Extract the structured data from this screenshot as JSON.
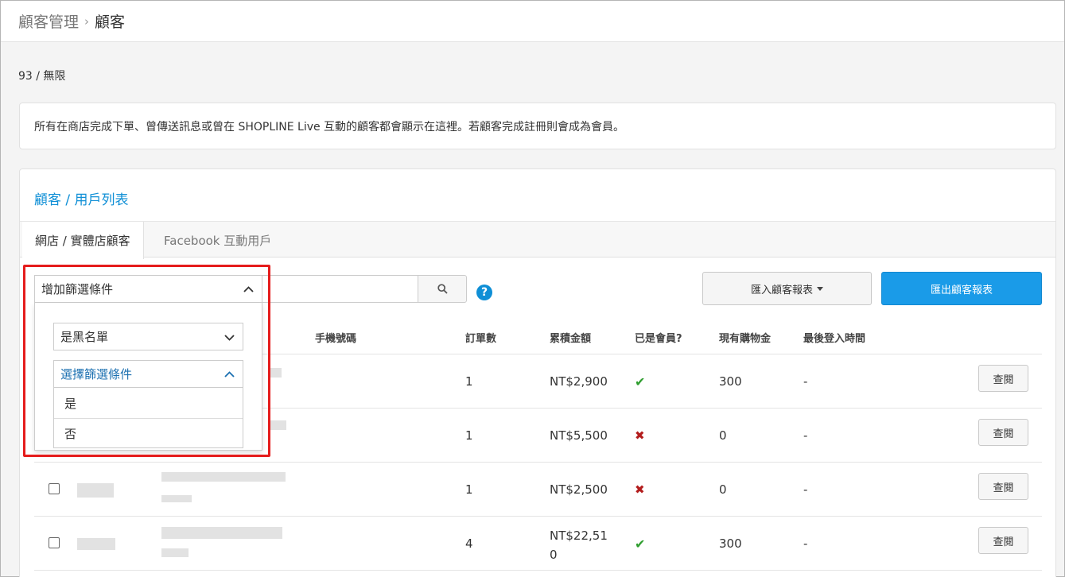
{
  "breadcrumb": {
    "parent": "顧客管理",
    "separator": "›",
    "current": "顧客"
  },
  "quota": "93 / 無限",
  "notice": "所有在商店完成下單、曾傳送訊息或曾在 SHOPLINE Live 互動的顧客都會顯示在這裡。若顧客完成註冊則會成為會員。",
  "panel": {
    "title": "顧客 / 用戶列表",
    "tabs": [
      {
        "label": "網店 / 實體店顧客",
        "active": true
      },
      {
        "label": "Facebook 互動用戶",
        "active": false
      }
    ]
  },
  "filter": {
    "label": "增加篩選條件",
    "blacklist_select": "是黑名單",
    "condition_select": "選擇篩選條件",
    "options": [
      "是",
      "否"
    ]
  },
  "buttons": {
    "import": "匯入顧客報表",
    "export": "匯出顧客報表",
    "help": "?"
  },
  "table": {
    "columns": [
      "手機號碼",
      "訂單數",
      "累積金額",
      "已是會員?",
      "現有購物金",
      "最後登入時間"
    ],
    "view_label": "查閱",
    "rows": [
      {
        "orders": "1",
        "amount": "NT$2,900",
        "member": true,
        "credit": "300",
        "last_login": "-"
      },
      {
        "orders": "1",
        "amount": "NT$5,500",
        "member": false,
        "credit": "0",
        "last_login": "-"
      },
      {
        "orders": "1",
        "amount": "NT$2,500",
        "member": false,
        "credit": "0",
        "last_login": "-"
      },
      {
        "orders": "4",
        "amount": "NT$22,510",
        "amount_line1": "NT$22,51",
        "amount_line2": "0",
        "member": true,
        "credit": "300",
        "last_login": "-"
      }
    ]
  },
  "colors": {
    "accent": "#0f8fd6",
    "primary_button": "#1a9be8",
    "highlight": "#e51c1c",
    "success": "#2f9e2f",
    "danger": "#b31d1d"
  }
}
